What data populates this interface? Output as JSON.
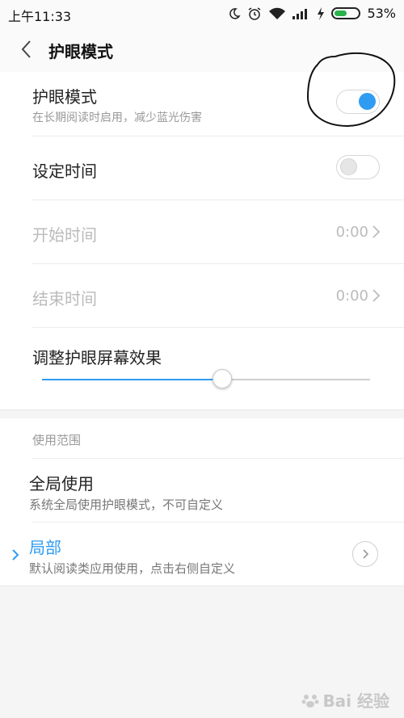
{
  "status": {
    "time": "上午11:33",
    "battery_pct_text": "53%",
    "battery_level": 0.53,
    "icons": [
      "moon-icon",
      "alarm-icon",
      "wifi-icon",
      "signal-icon",
      "charging-icon",
      "battery-icon"
    ]
  },
  "header": {
    "title": "护眼模式",
    "back_icon": "chevron-left-icon"
  },
  "settings": {
    "eye_mode": {
      "title": "护眼模式",
      "subtitle": "在长期阅读时启用，减少蓝光伤害",
      "enabled": true
    },
    "schedule": {
      "title": "设定时间",
      "enabled": false
    },
    "start_time": {
      "title": "开始时间",
      "value": "0:00"
    },
    "end_time": {
      "title": "结束时间",
      "value": "0:00"
    },
    "effect": {
      "title": "调整护眼屏幕效果",
      "level": 0.55
    }
  },
  "scope": {
    "label": "使用范围",
    "options": [
      {
        "title": "全局使用",
        "subtitle": "系统全局使用护眼模式，不可自定义",
        "selected": false
      },
      {
        "title": "局部",
        "subtitle": "默认阅读类应用使用，点击右侧自定义",
        "selected": true
      }
    ]
  },
  "colors": {
    "accent": "#2f9cf3",
    "disabled_text": "#bbbbbb",
    "annotation": "#111111"
  },
  "watermark": {
    "text": "Bai 经验"
  }
}
